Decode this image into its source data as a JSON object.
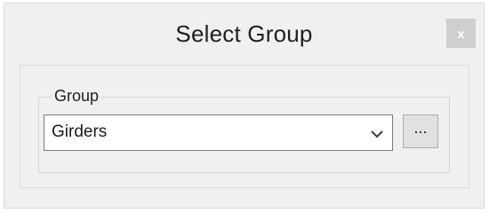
{
  "dialog": {
    "title": "Select Group",
    "close_label": "x"
  },
  "group": {
    "legend": "Group",
    "combo_value": "Girders",
    "browse_label": "..."
  }
}
